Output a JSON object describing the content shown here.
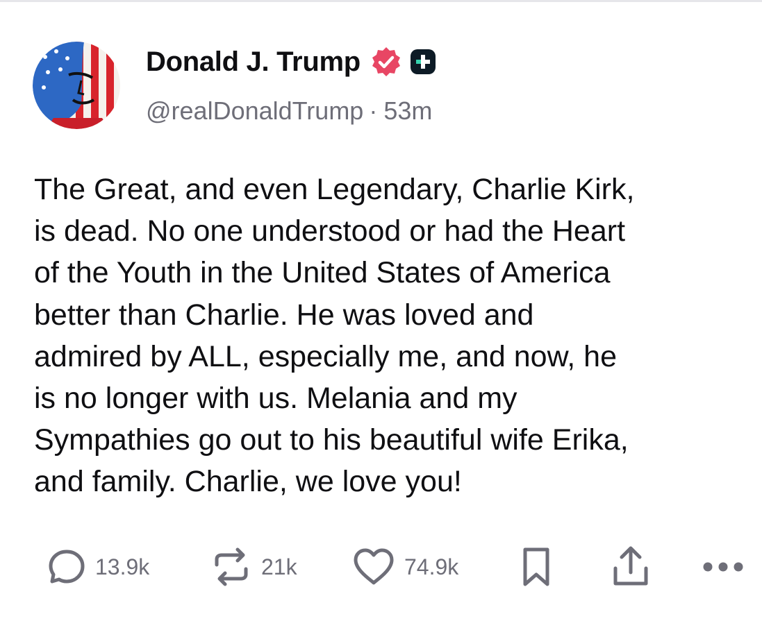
{
  "author": {
    "display_name": "Donald J. Trump",
    "handle": "@realDonaldTrump",
    "separator": "·",
    "time_ago": "53m",
    "verified": true
  },
  "post": {
    "lines": [
      "The Great, and even Legendary, Charlie Kirk,",
      "is dead. No one understood or had the Heart",
      "of the Youth in the United States of America",
      "better than Charlie. He was loved and",
      "admired by ALL, especially me, and now, he",
      "is no longer with us. Melania and my",
      "Sympathies go out to his beautiful wife Erika,",
      "and family. Charlie, we love you!"
    ]
  },
  "actions": {
    "replies": "13.9k",
    "retruths": "21k",
    "likes": "74.9k"
  },
  "icons": {
    "reply": "speech-bubble-icon",
    "retruth": "repost-arrows-icon",
    "like": "heart-icon",
    "bookmark": "bookmark-icon",
    "share": "share-upload-icon",
    "more": "ellipsis-icon",
    "verified": "verified-badge-icon",
    "plus": "plus-badge-icon"
  },
  "colors": {
    "text": "#0f0f12",
    "muted": "#6e6e78",
    "verified_badge": "#e84664",
    "plus_badge": "#0d1b26",
    "plus_badge_accent": "#36d4b0"
  }
}
